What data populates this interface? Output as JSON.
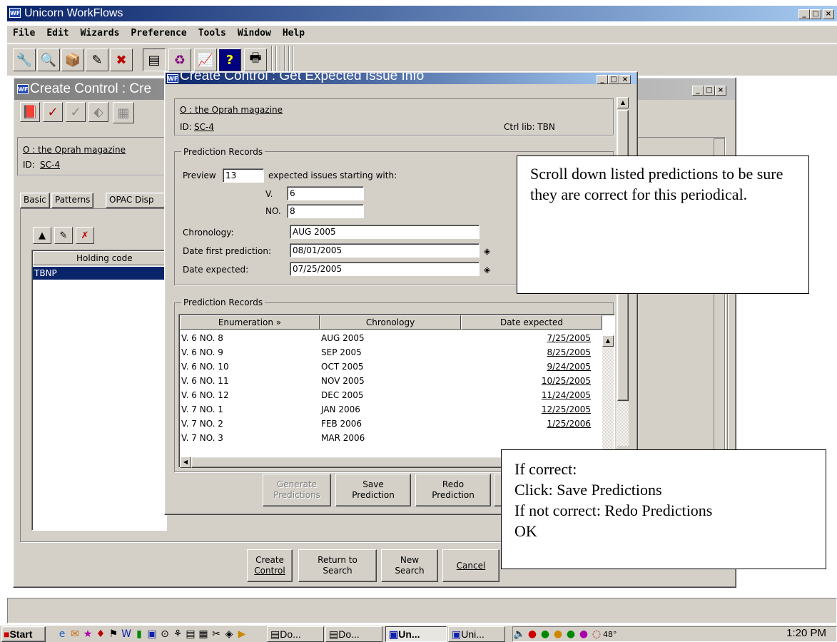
{
  "app": {
    "title": "Unicorn WorkFlows",
    "icon": "WF",
    "window_controls": [
      "_",
      "□",
      "×"
    ]
  },
  "menu": [
    "File",
    "Edit",
    "Wizards",
    "Preference",
    "Tools",
    "Window",
    "Help"
  ],
  "toolbar_icons": [
    "checkin-icon",
    "search-user-icon",
    "item-icon",
    "edit-item-icon",
    "delete-item-icon",
    "serials-icon",
    "circulation-icon",
    "reports-icon",
    "help-icon",
    "print-icon"
  ],
  "back_window": {
    "title": "Create Control : Cre",
    "title_name": "O : the Oprah magazine",
    "id_label": "ID:",
    "id_value": "SC-4",
    "tabs": [
      "Basic",
      "Patterns",
      "OPAC Disp"
    ],
    "grid_header": "Holding code",
    "grid_rows": [
      "TBNP"
    ],
    "buttons": {
      "create": [
        "Create",
        "Control"
      ],
      "return": [
        "Return to",
        "Search"
      ],
      "new": [
        "New",
        "Search"
      ],
      "cancel": "Cancel"
    }
  },
  "dialog": {
    "title": "Create Control : Get Expected Issue Info",
    "record_title": "O : the Oprah magazine",
    "id_label": "ID:",
    "id_value": "SC-4",
    "ctrl_lib": "Ctrl lib: TBN",
    "group1_label": "Prediction Records",
    "preview_label": "Preview",
    "preview_value": "13",
    "expected_label": "expected issues starting with:",
    "v_label": "V.",
    "v_value": "6",
    "no_label": "NO.",
    "no_value": "8",
    "chronology_label": "Chronology:",
    "chronology_value": "AUG 2005",
    "date_first_label": "Date first prediction:",
    "date_first_value": "08/01/2005",
    "date_expected_label": "Date expected:",
    "date_expected_value": "07/25/2005",
    "group2_label": "Prediction Records",
    "columns": [
      "Enumeration »",
      "Chronology",
      "Date expected"
    ],
    "rows": [
      {
        "enum": "V. 6 NO. 8",
        "chron": "AUG 2005",
        "date": "7/25/2005"
      },
      {
        "enum": "V. 6 NO. 9",
        "chron": "SEP 2005",
        "date": "8/25/2005"
      },
      {
        "enum": "V. 6 NO. 10",
        "chron": "OCT 2005",
        "date": "9/24/2005"
      },
      {
        "enum": "V. 6 NO. 11",
        "chron": "NOV 2005",
        "date": "10/25/2005"
      },
      {
        "enum": "V. 6 NO. 12",
        "chron": "DEC 2005",
        "date": "11/24/2005"
      },
      {
        "enum": "V. 7 NO. 1",
        "chron": "JAN 2006",
        "date": "12/25/2005"
      },
      {
        "enum": "V. 7 NO. 2",
        "chron": "FEB 2006",
        "date": "1/25/2006"
      },
      {
        "enum": "V. 7 NO. 3",
        "chron": "MAR 2006",
        "date": ""
      }
    ],
    "buttons": {
      "generate": [
        "Generate",
        "Predictions"
      ],
      "save": [
        "Save",
        "Prediction"
      ],
      "redo": [
        "Redo",
        "Prediction"
      ]
    }
  },
  "callouts": {
    "top": "Scroll down listed predictions to be sure they are correct for this periodical.",
    "bottom": [
      "If correct:",
      "Click: Save Predictions",
      "If not correct: Redo Predictions",
      "OK"
    ]
  },
  "taskbar": {
    "start": "Start",
    "tasks": [
      "Do...",
      "Do...",
      "Un...",
      "Uni..."
    ],
    "clock": "1:20 PM",
    "temp": "48°"
  }
}
